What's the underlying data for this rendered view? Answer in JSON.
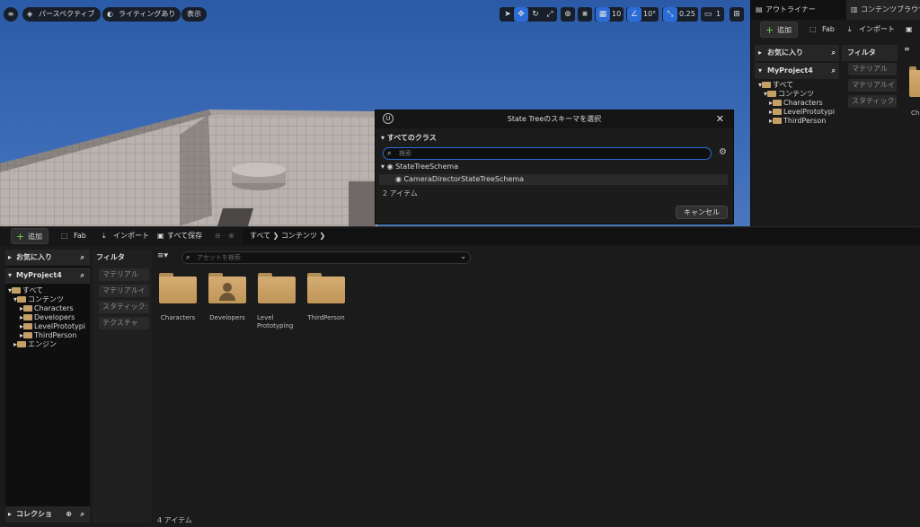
{
  "viewport": {
    "toolbar": {
      "menu_icon": "hamburger-icon",
      "perspective_label": "パースペクティブ",
      "lighting_label": "ライティングあり",
      "show_label": "表示",
      "grid_snap_value": "10",
      "rotation_snap_value": "10°",
      "scale_snap_value": "0.25",
      "camera_speed_value": "1"
    }
  },
  "right_panel": {
    "tabs": [
      "アウトライナー",
      "コンテンツブラウザ"
    ],
    "add_label": "追加",
    "fab_label": "Fab",
    "import_label": "インポート",
    "favorites_label": "お気に入り",
    "project_label": "MyProject4",
    "filter_header": "フィルタ",
    "tree": [
      {
        "label": "すべて",
        "level": 0
      },
      {
        "label": "コンテンツ",
        "level": 1
      },
      {
        "label": "Characters",
        "level": 2
      },
      {
        "label": "LevelPrototypi",
        "level": 2
      },
      {
        "label": "ThirdPerson",
        "level": 2
      }
    ],
    "filters": [
      "マテリアル",
      "マテリアルイ",
      "スタティック:"
    ],
    "folder_label": "Ch"
  },
  "dialog": {
    "title": "State Treeのスキーマを選択",
    "section": "すべてのクラス",
    "search_placeholder": "検索",
    "items": [
      {
        "label": "StateTreeSchema",
        "level": 0
      },
      {
        "label": "CameraDirectorStateTreeSchema",
        "level": 1
      }
    ],
    "count": "2 アイテム",
    "cancel_label": "キャンセル"
  },
  "content_browser": {
    "toolbar": {
      "add_label": "追加",
      "fab_label": "Fab",
      "import_label": "インポート",
      "save_all_label": "すべて保存",
      "breadcrumb": [
        "すべて",
        "コンテンツ"
      ]
    },
    "favorites_label": "お気に入り",
    "project_label": "MyProject4",
    "filter_header": "フィルタ",
    "tree": [
      {
        "label": "すべて",
        "level": 0
      },
      {
        "label": "コンテンツ",
        "level": 1
      },
      {
        "label": "Characters",
        "level": 2
      },
      {
        "label": "Developers",
        "level": 2
      },
      {
        "label": "LevelPrototypi",
        "level": 2
      },
      {
        "label": "ThirdPerson",
        "level": 2
      },
      {
        "label": "エンジン",
        "level": 0
      }
    ],
    "filters": [
      "マテリアル",
      "マテリアルイ",
      "スタティック:",
      "テクスチャ"
    ],
    "search_placeholder": "アセットを検索",
    "folders": [
      {
        "label": "Characters"
      },
      {
        "label": "Developers"
      },
      {
        "label": "Level Prototyping"
      },
      {
        "label": "ThirdPerson"
      }
    ],
    "count": "4 アイテム",
    "collections_label": "コレクショ"
  },
  "colors": {
    "accent_blue": "#2b6cd6",
    "add_green": "#6fd14a",
    "folder": "#c4a066",
    "sky": "#3b6ab6"
  }
}
